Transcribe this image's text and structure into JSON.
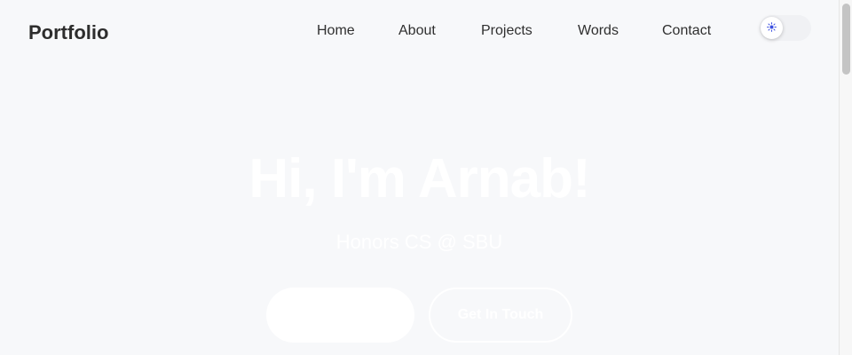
{
  "nav": {
    "brand": "Portfolio",
    "links": [
      "Home",
      "About",
      "Projects",
      "Words",
      "Contact"
    ],
    "theme_toggle_icon": "sun-icon"
  },
  "hero": {
    "title": "Hi, I'm Arnab!",
    "subtitle": "Honors CS @ SBU",
    "primary_button": "",
    "secondary_button": "Get In Touch"
  },
  "colors": {
    "background": "#f7f8fa",
    "text": "#2d2d2d",
    "hero_text": "#ffffff",
    "sun_icon": "#3b4fe0"
  }
}
